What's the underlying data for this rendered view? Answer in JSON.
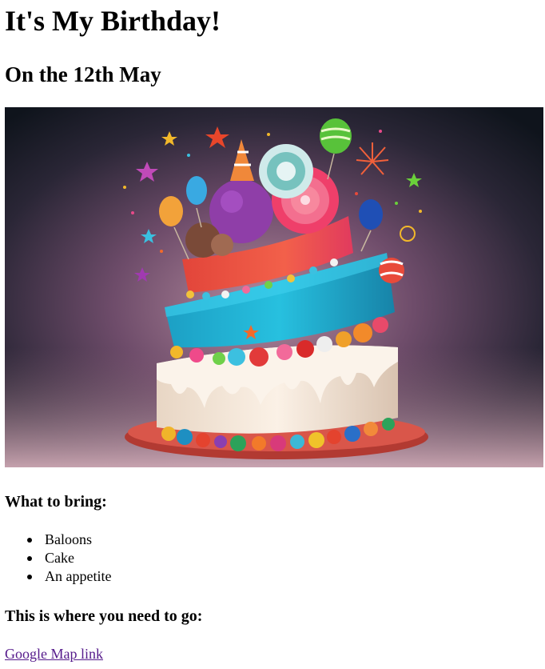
{
  "page": {
    "title": "It's My Birthday!",
    "subtitle": "On the 12th May",
    "bring_heading": "What to bring:",
    "bring_items": [
      "Baloons",
      "Cake",
      "An appetite"
    ],
    "where_heading": "This is where you need to go:",
    "map_link_label": "Google Map link"
  },
  "colors": {
    "link_visited": "#551a8b",
    "text": "#000000",
    "background": "#ffffff"
  },
  "image": {
    "semantic": "birthday-cake-image"
  }
}
